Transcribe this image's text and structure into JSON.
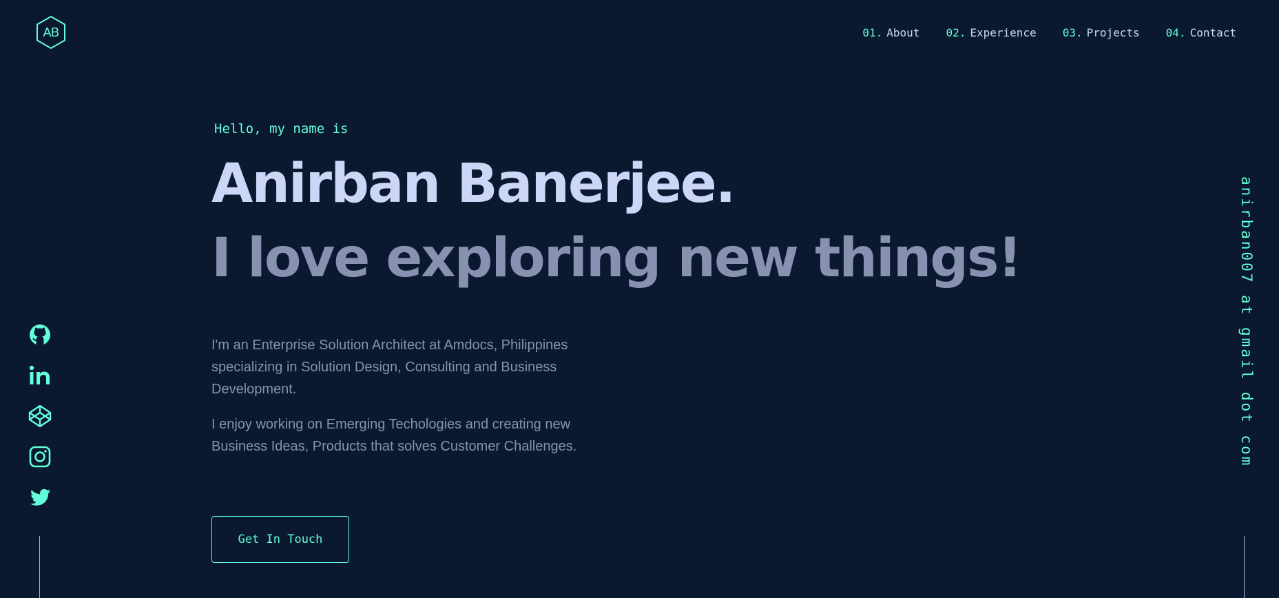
{
  "header": {
    "logo_text": "AB",
    "nav": [
      {
        "num": "01.",
        "label": "About"
      },
      {
        "num": "02.",
        "label": "Experience"
      },
      {
        "num": "03.",
        "label": "Projects"
      },
      {
        "num": "04.",
        "label": "Contact"
      }
    ]
  },
  "hero": {
    "greeting": "Hello, my name is",
    "name": "Anirban Banerjee.",
    "tagline": "I love exploring new things!",
    "bio": [
      "I'm an Enterprise Solution Architect at Amdocs, Philippines specializing in Solution Design, Consulting and Business Development.",
      "I enjoy working on Emerging Techologies and creating new Business Ideas, Products that solves Customer Challenges."
    ],
    "cta_label": "Get In Touch"
  },
  "social": {
    "icons": [
      "github-icon",
      "linkedin-icon",
      "codepen-icon",
      "instagram-icon",
      "twitter-icon"
    ]
  },
  "email_sidebar": {
    "text": "anirban007 at gmail dot com"
  },
  "colors": {
    "background": "#0a192f",
    "accent": "#64ffda",
    "heading": "#ccd6f6",
    "text": "#8892b0"
  }
}
